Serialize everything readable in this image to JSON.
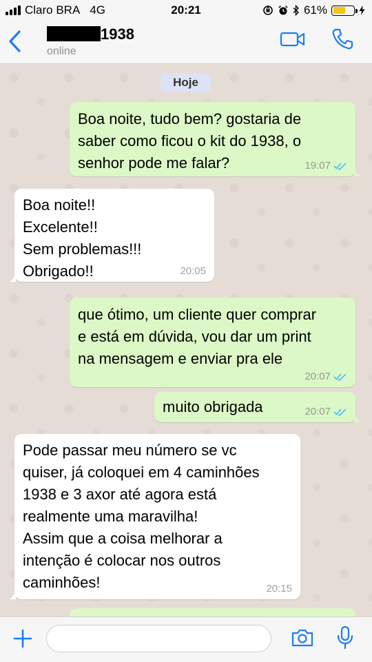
{
  "status_bar": {
    "carrier": "Claro BRA",
    "network": "4G",
    "time": "20:21",
    "battery_percent": "61%",
    "battery_level": 0.61
  },
  "header": {
    "contact_name_suffix": "1938",
    "contact_status": "online"
  },
  "chat": {
    "day_separator": "Hoje",
    "messages": [
      {
        "direction": "out",
        "text": "Boa noite, tudo bem? gostaria de\nsaber como ficou o kit do 1938, o\nsenhor pode me falar?",
        "time": "19:07",
        "status": "read"
      },
      {
        "direction": "in",
        "text": "Boa noite!!\nExcelente!!\nSem problemas!!!\nObrigado!!",
        "time": "20:05"
      },
      {
        "direction": "out",
        "text": "que ótimo, um cliente quer comprar\ne está em dúvida, vou dar um print\nna mensagem e enviar pra ele",
        "time": "20:07",
        "status": "read"
      },
      {
        "direction": "out",
        "text": "muito obrigada",
        "time": "20:07",
        "status": "read"
      },
      {
        "direction": "in",
        "text": "Pode passar meu número se vc\nquiser, já coloquei em 4  caminhões\n1938 e 3 axor até agora está\nrealmente uma maravilha!\nAssim que a coisa melhorar a\nintenção é colocar nos outros\ncaminhões!",
        "time": "20:15"
      }
    ]
  },
  "input_bar": {
    "message_value": "",
    "message_placeholder": ""
  },
  "colors": {
    "accent_blue": "#1a7cf5",
    "outgoing_bubble": "#dcf8c6",
    "incoming_bubble": "#ffffff",
    "read_ticks": "#4fc3f7",
    "battery_fill": "#f5c518"
  }
}
